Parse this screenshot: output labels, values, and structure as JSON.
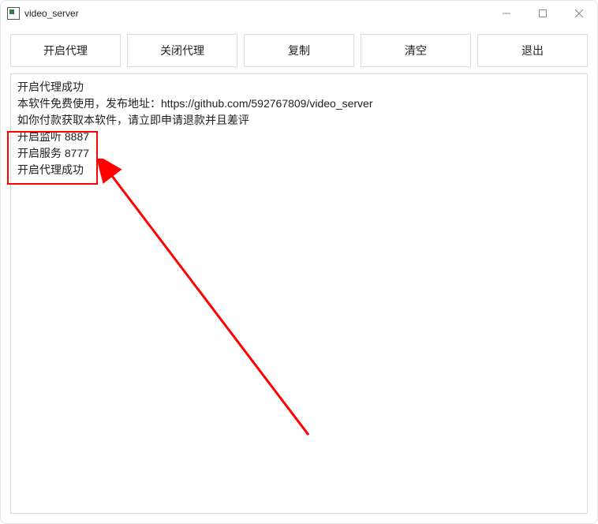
{
  "window": {
    "title": "video_server"
  },
  "toolbar": {
    "start_proxy": "开启代理",
    "stop_proxy": "关闭代理",
    "copy": "复制",
    "clear": "清空",
    "exit": "退出"
  },
  "log": {
    "lines": [
      "开启代理成功",
      "本软件免费使用，发布地址：https://github.com/592767809/video_server",
      "如你付款获取本软件，请立即申请退款并且差评",
      "开启监听 8887",
      "开启服务 8777",
      "开启代理成功"
    ]
  }
}
